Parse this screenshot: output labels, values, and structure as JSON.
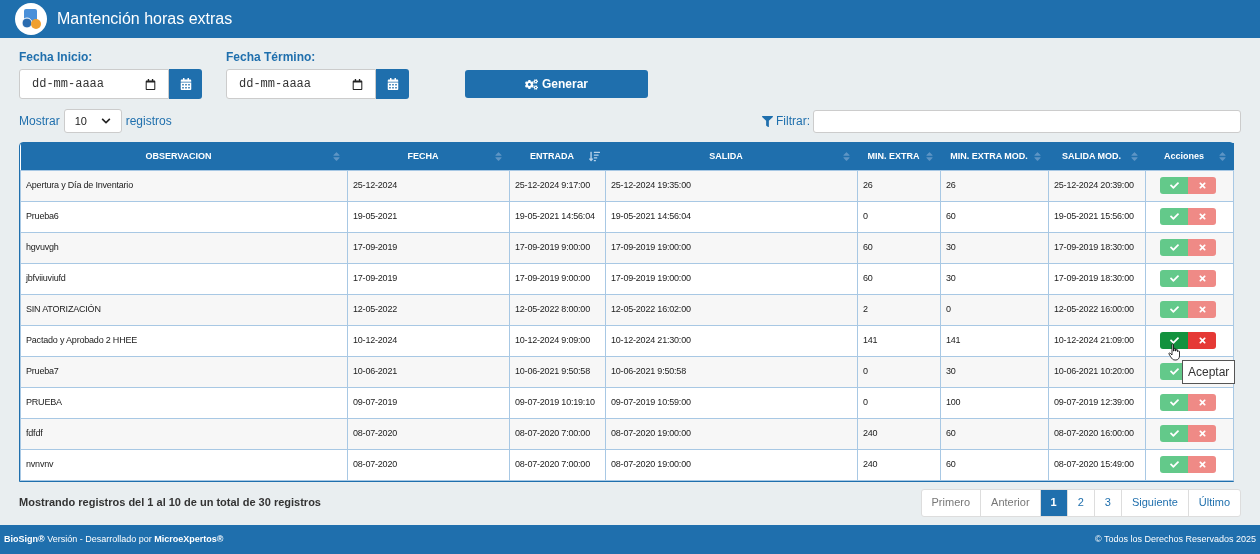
{
  "header": {
    "title": "Mantención horas extras"
  },
  "filters": {
    "start_label": "Fecha Inicio:",
    "start_placeholder": "dd-mm-aaaa",
    "end_label": "Fecha Término:",
    "end_placeholder": "dd-mm-aaaa",
    "generate_button": "Generar"
  },
  "length": {
    "before": "Mostrar",
    "value": "10",
    "after": "registros"
  },
  "search": {
    "label": "Filtrar:"
  },
  "table": {
    "columns": [
      {
        "label": "OBSERVACION",
        "sorted": false
      },
      {
        "label": "FECHA",
        "sorted": false
      },
      {
        "label": "ENTRADA",
        "sorted": true
      },
      {
        "label": "SALIDA",
        "sorted": false
      },
      {
        "label": "MIN. EXTRA",
        "sorted": false
      },
      {
        "label": "MIN. EXTRA MOD.",
        "sorted": false
      },
      {
        "label": "SALIDA MOD.",
        "sorted": false
      },
      {
        "label": "Acciones",
        "sorted": false
      }
    ],
    "rows": [
      {
        "cells": [
          "Apertura y Día de Inventario",
          "25-12-2024",
          "25-12-2024 9:17:00",
          "25-12-2024 19:35:00",
          "26",
          "26",
          "25-12-2024 20:39:00"
        ],
        "hovered": false
      },
      {
        "cells": [
          "Prueba6",
          "19-05-2021",
          "19-05-2021 14:56:04",
          "19-05-2021 14:56:04",
          "0",
          "60",
          "19-05-2021 15:56:00"
        ],
        "hovered": false
      },
      {
        "cells": [
          "hgvuvgh",
          "17-09-2019",
          "17-09-2019 9:00:00",
          "17-09-2019 19:00:00",
          "60",
          "30",
          "17-09-2019 18:30:00"
        ],
        "hovered": false
      },
      {
        "cells": [
          "jbfviiuviufd",
          "17-09-2019",
          "17-09-2019 9:00:00",
          "17-09-2019 19:00:00",
          "60",
          "30",
          "17-09-2019 18:30:00"
        ],
        "hovered": false
      },
      {
        "cells": [
          "SIN ATORIZACIÓN",
          "12-05-2022",
          "12-05-2022 8:00:00",
          "12-05-2022 16:02:00",
          "2",
          "0",
          "12-05-2022 16:00:00"
        ],
        "hovered": false
      },
      {
        "cells": [
          "Pactado y Aprobado 2 HHEE",
          "10-12-2024",
          "10-12-2024 9:09:00",
          "10-12-2024 21:30:00",
          "141",
          "141",
          "10-12-2024 21:09:00"
        ],
        "hovered": true
      },
      {
        "cells": [
          "Prueba7",
          "10-06-2021",
          "10-06-2021 9:50:58",
          "10-06-2021 9:50:58",
          "0",
          "30",
          "10-06-2021 10:20:00"
        ],
        "hovered": false
      },
      {
        "cells": [
          "PRUEBA",
          "09-07-2019",
          "09-07-2019 10:19:10",
          "09-07-2019 10:59:00",
          "0",
          "100",
          "09-07-2019 12:39:00"
        ],
        "hovered": false
      },
      {
        "cells": [
          "fdfdf",
          "08-07-2020",
          "08-07-2020 7:00:00",
          "08-07-2020 19:00:00",
          "240",
          "60",
          "08-07-2020 16:00:00"
        ],
        "hovered": false
      },
      {
        "cells": [
          "nvnvnv",
          "08-07-2020",
          "08-07-2020 7:00:00",
          "08-07-2020 19:00:00",
          "240",
          "60",
          "08-07-2020 15:49:00"
        ],
        "hovered": false
      }
    ]
  },
  "tooltip": "Aceptar",
  "info": "Mostrando registros del 1 al 10 de un total de 30 registros",
  "pagination": [
    {
      "label": "Primero",
      "selected": false,
      "disabled": true
    },
    {
      "label": "Anterior",
      "selected": false,
      "disabled": true
    },
    {
      "label": "1",
      "selected": true,
      "disabled": false
    },
    {
      "label": "2",
      "selected": false,
      "disabled": false
    },
    {
      "label": "3",
      "selected": false,
      "disabled": false
    },
    {
      "label": "Siguiente",
      "selected": false,
      "disabled": false
    },
    {
      "label": "Último",
      "selected": false,
      "disabled": false
    }
  ],
  "footer": {
    "left": "**BioSign®** Versión - Desarrollado por **MicroeXpertos®**",
    "right": "© Todos los Derechos Reservados 2025"
  }
}
